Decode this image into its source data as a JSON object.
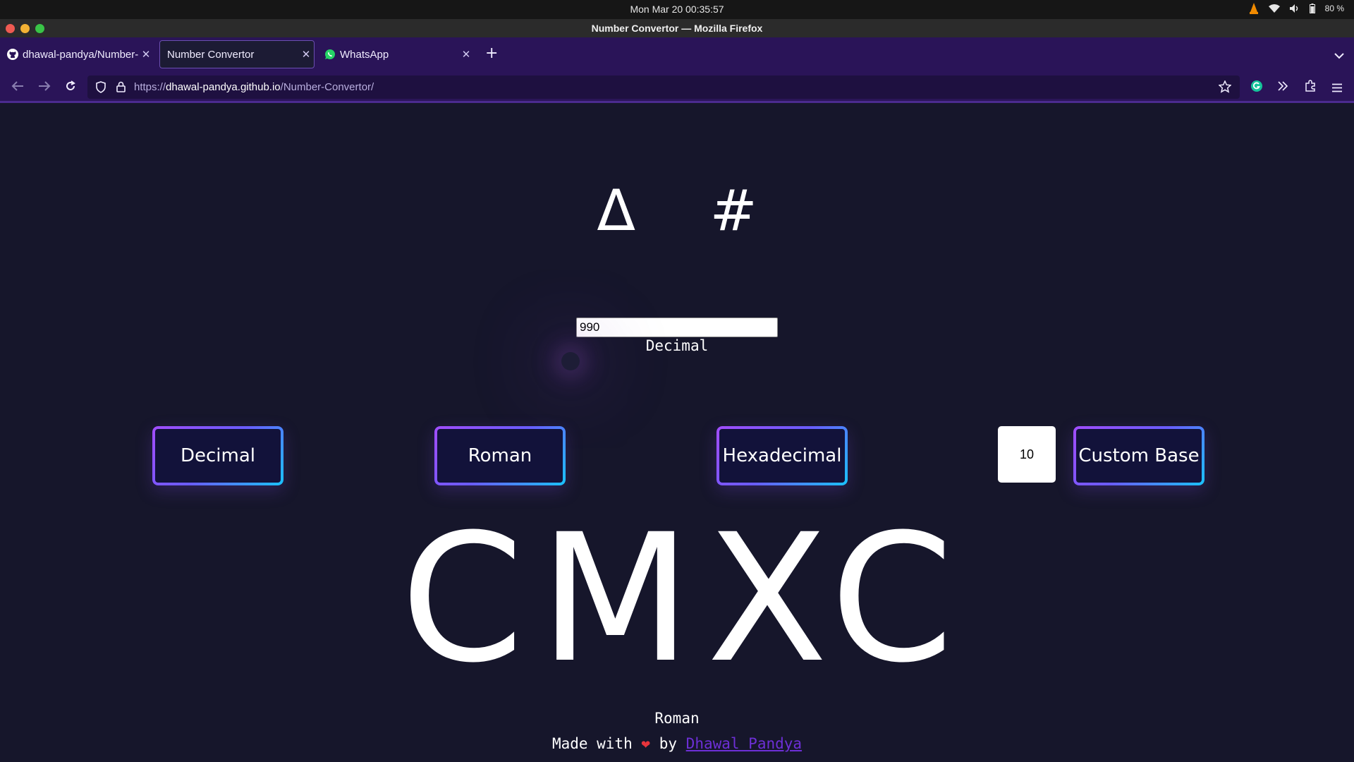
{
  "os": {
    "clock": "Mon Mar 20  00:35:57",
    "battery": "80 %"
  },
  "browser": {
    "window_title": "Number Convertor — Mozilla Firefox",
    "tabs": [
      {
        "label": "dhawal-pandya/Number-Convertor",
        "icon": "github-icon",
        "active": false
      },
      {
        "label": "Number Convertor",
        "icon": "",
        "active": true
      },
      {
        "label": "WhatsApp",
        "icon": "whatsapp-icon",
        "active": false
      }
    ],
    "url_prefix": "https://",
    "url_domain": "dhawal-pandya.github.io",
    "url_path": "/Number-Convertor/"
  },
  "page": {
    "logo": "Δ #",
    "input_value": "990",
    "input_type_label": "Decimal",
    "buttons": {
      "decimal": "Decimal",
      "roman": "Roman",
      "hexadecimal": "Hexadecimal",
      "custom_base": "Custom Base"
    },
    "base_value": "10",
    "result": "CMXC",
    "result_type_label": "Roman",
    "footer_prefix": "Made with",
    "footer_by": "by",
    "footer_author": "Dhawal Pandya"
  },
  "colors": {
    "page_bg": "#16162b",
    "tabbar_bg": "#2a1458",
    "button_gradient_start": "#a24dff",
    "button_gradient_end": "#19c3ff",
    "heart": "#e8343c",
    "author_link": "#6d2fd6"
  }
}
